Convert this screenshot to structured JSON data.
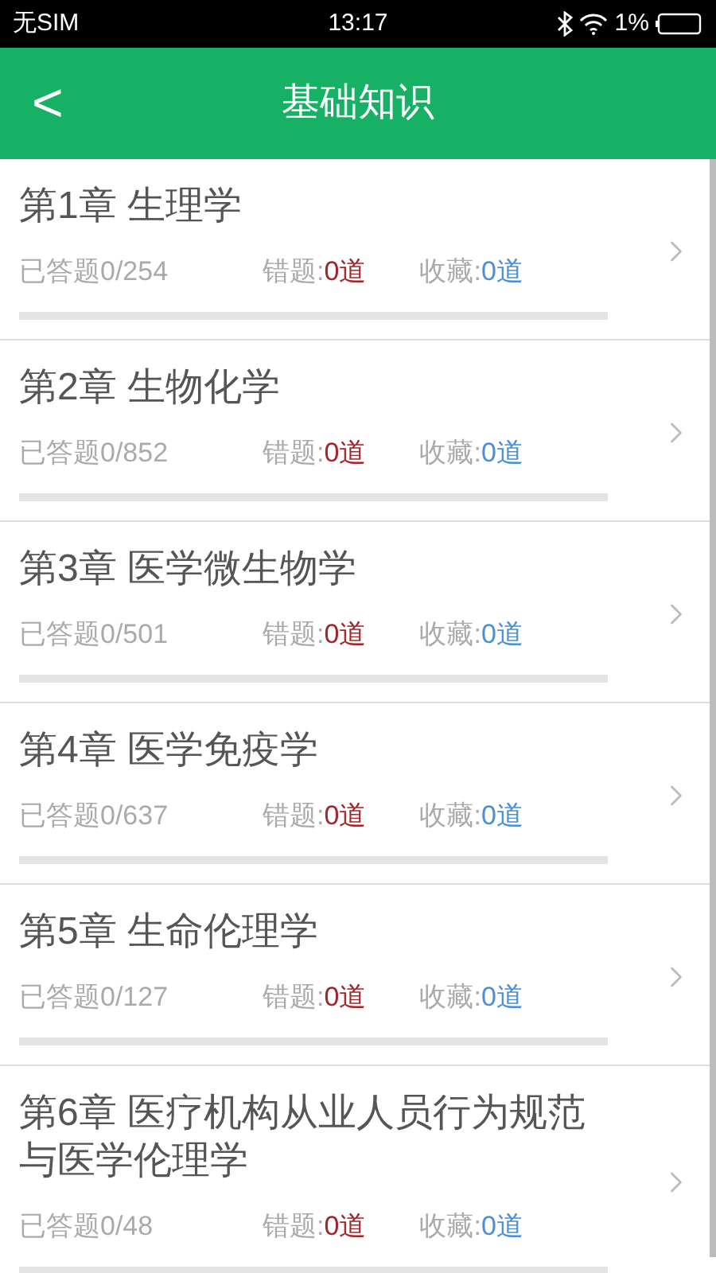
{
  "status_bar": {
    "carrier": "无SIM",
    "time": "13:17",
    "battery": "1%"
  },
  "header": {
    "back": "<",
    "title": "基础知识"
  },
  "chapters": [
    {
      "title": "第1章 生理学",
      "answered": "已答题0/254",
      "wrong_label": "错题:",
      "wrong_value": "0道",
      "fav_label": "收藏:",
      "fav_value": "0道",
      "level": 0
    },
    {
      "title": "第2章 生物化学",
      "answered": "已答题0/852",
      "wrong_label": "错题:",
      "wrong_value": "0道",
      "fav_label": "收藏:",
      "fav_value": "0道",
      "level": 0
    },
    {
      "title": "第3章 医学微生物学",
      "answered": "已答题0/501",
      "wrong_label": "错题:",
      "wrong_value": "0道",
      "fav_label": "收藏:",
      "fav_value": "0道",
      "level": 0
    },
    {
      "title": "第4章 医学免疫学",
      "answered": "已答题0/637",
      "wrong_label": "错题:",
      "wrong_value": "0道",
      "fav_label": "收藏:",
      "fav_value": "0道",
      "level": 0
    },
    {
      "title": "第5章 生命伦理学",
      "answered": "已答题0/127",
      "wrong_label": "错题:",
      "wrong_value": "0道",
      "fav_label": "收藏:",
      "fav_value": "0道",
      "level": 0
    },
    {
      "title": "第6章 医疗机构从业人员行为规范与医学伦理学",
      "answered": "已答题0/48",
      "wrong_label": "错题:",
      "wrong_value": "0道",
      "fav_label": "收藏:",
      "fav_value": "0道",
      "level": 0
    }
  ]
}
